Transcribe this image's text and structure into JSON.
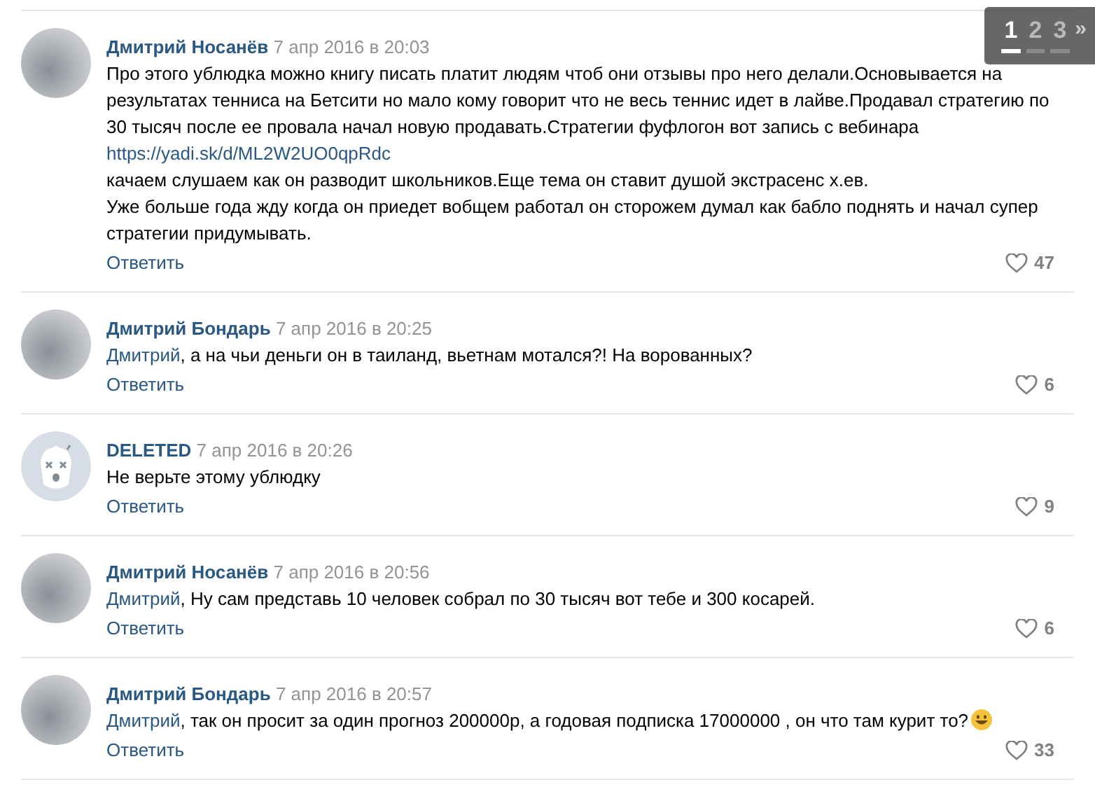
{
  "pager": {
    "pages": [
      {
        "label": "1",
        "selected": true
      },
      {
        "label": "2",
        "selected": false
      },
      {
        "label": "3",
        "selected": false
      }
    ],
    "next": "»"
  },
  "comments": [
    {
      "avatar": {
        "kind": "photo"
      },
      "author": "Дмитрий Носанёв",
      "date": "7 апр 2016 в 20:03",
      "body": [
        {
          "kind": "text",
          "text": "Про этого ублюдка можно книгу писать платит людям чтоб они отзывы про него делали.Основывается на результатах тенниса на Бетсити но мало кому говорит что не весь теннис идет в лайве.Продавал стратегию по 30 тысяч после ее провала начал новую продавать.Стратегии фуфлогон вот запись с вебинара"
        },
        {
          "kind": "link",
          "text": "https://yadi.sk/d/ML2W2UO0qpRdc"
        },
        {
          "kind": "text",
          "text": "качаем слушаем как он разводит школьников.Еще тема он ставит душой экстрасенс х.ев."
        },
        {
          "kind": "text",
          "text": "Уже больше года жду когда он приедет вобщем работал он сторожем думал как бабло поднять и начал супер стратегии придумывать."
        }
      ],
      "reply": "Ответить",
      "likes": "47"
    },
    {
      "avatar": {
        "kind": "photo"
      },
      "author": "Дмитрий Бондарь",
      "date": "7 апр 2016 в 20:25",
      "body": [
        {
          "kind": "mention",
          "text": "Дмитрий",
          "rest": ", а на чьи деньги он в таиланд, вьетнам мотался?! На ворованных?"
        }
      ],
      "reply": "Ответить",
      "likes": "6"
    },
    {
      "avatar": {
        "kind": "deleted"
      },
      "author": "DELETED",
      "date": "7 апр 2016 в 20:26",
      "body": [
        {
          "kind": "text",
          "text": "Не верьте этому ублюдку"
        }
      ],
      "reply": "Ответить",
      "likes": "9"
    },
    {
      "avatar": {
        "kind": "photo"
      },
      "author": "Дмитрий Носанёв",
      "date": "7 апр 2016 в 20:56",
      "body": [
        {
          "kind": "mention",
          "text": "Дмитрий",
          "rest": ", Ну сам представь 10 человек собрал по 30 тысяч вот тебе и 300 косарей."
        }
      ],
      "reply": "Ответить",
      "likes": "6"
    },
    {
      "avatar": {
        "kind": "photo"
      },
      "author": "Дмитрий Бондарь",
      "date": "7 апр 2016 в 20:57",
      "body": [
        {
          "kind": "mention",
          "text": "Дмитрий",
          "rest": ", так он просит за один прогноз 200000р, а годовая подписка 17000000 , он что там курит то?",
          "emoji": true
        }
      ],
      "reply": "Ответить",
      "likes": "33"
    }
  ]
}
